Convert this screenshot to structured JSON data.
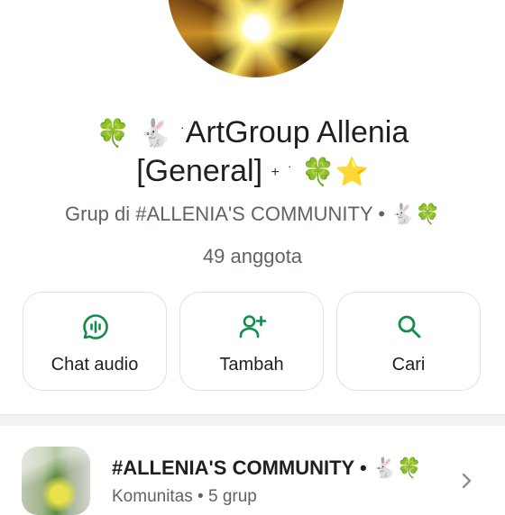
{
  "group": {
    "title_line1_emoji_clover": "🍀",
    "title_line1_emoji_rabbit": "🐇",
    "title_line1_mark": "˙",
    "title_line1_text": "ArtGroup Allenia",
    "title_line2_text": "[General]",
    "title_line2_plus": "+",
    "title_line2_mark": "˙",
    "title_line2_emoji_clover": "🍀",
    "title_line2_emoji_star": "⭐",
    "subtitle_text": "Grup di #ALLENIA'S COMMUNITY •",
    "subtitle_emoji_rabbit": "🐇",
    "subtitle_emoji_clover": "🍀",
    "members": "49 anggota"
  },
  "actions": [
    {
      "label": "Chat audio",
      "icon": "audio-chat-icon"
    },
    {
      "label": "Tambah",
      "icon": "add-person-icon"
    },
    {
      "label": "Cari",
      "icon": "search-icon"
    }
  ],
  "community": {
    "name": "#ALLENIA'S COMMUNITY •",
    "emoji_rabbit": "🐇",
    "emoji_clover": "🍀",
    "subtitle": "Komunitas • 5 grup"
  },
  "colors": {
    "accent": "#128c4a",
    "text": "#1f1f1f",
    "secondary_text": "#5f6368"
  }
}
